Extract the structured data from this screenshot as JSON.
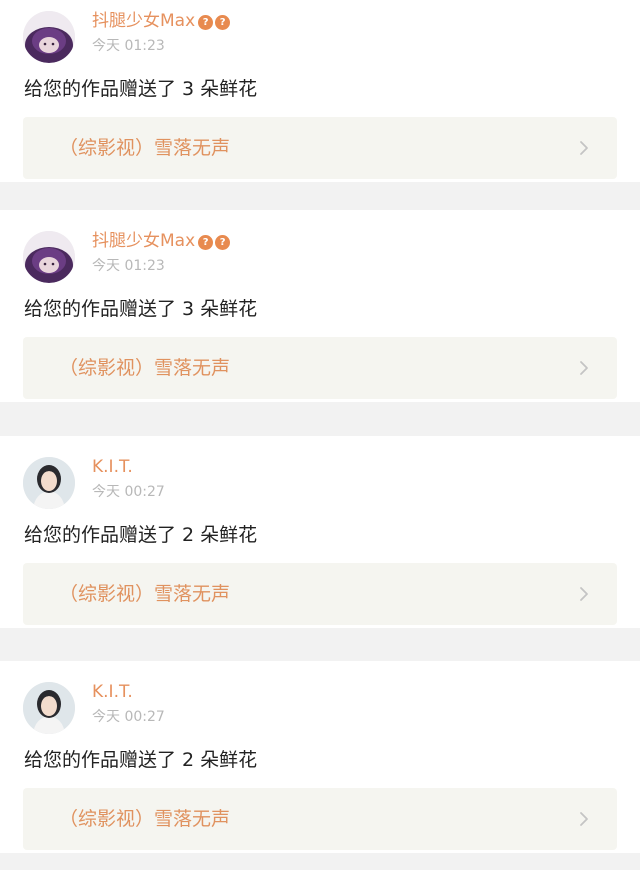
{
  "notifications": [
    {
      "username": "抖腿少女Max",
      "badges": [
        "?",
        "?"
      ],
      "time": "今天 01:23",
      "message": "给您的作品赠送了 3 朵鲜花",
      "work_title": "（综影视）雪落无声",
      "avatar_icon": "avatar-purple-hair"
    },
    {
      "username": "抖腿少女Max",
      "badges": [
        "?",
        "?"
      ],
      "time": "今天 01:23",
      "message": "给您的作品赠送了 3 朵鲜花",
      "work_title": "（综影视）雪落无声",
      "avatar_icon": "avatar-purple-hair"
    },
    {
      "username": "K.I.T.",
      "badges": [],
      "time": "今天 00:27",
      "message": "给您的作品赠送了 2 朵鲜花",
      "work_title": "（综影视）雪落无声",
      "avatar_icon": "avatar-girl-photo"
    },
    {
      "username": "K.I.T.",
      "badges": [],
      "time": "今天 00:27",
      "message": "给您的作品赠送了 2 朵鲜花",
      "work_title": "（综影视）雪落无声",
      "avatar_icon": "avatar-girl-photo"
    }
  ],
  "colors": {
    "username": "#e6915e",
    "badge": "#e88a4f",
    "time": "#b8b8b8",
    "message": "#222222",
    "work_title": "#e0925f",
    "work_bg": "#f5f5f0",
    "separator": "#f2f2f2"
  }
}
